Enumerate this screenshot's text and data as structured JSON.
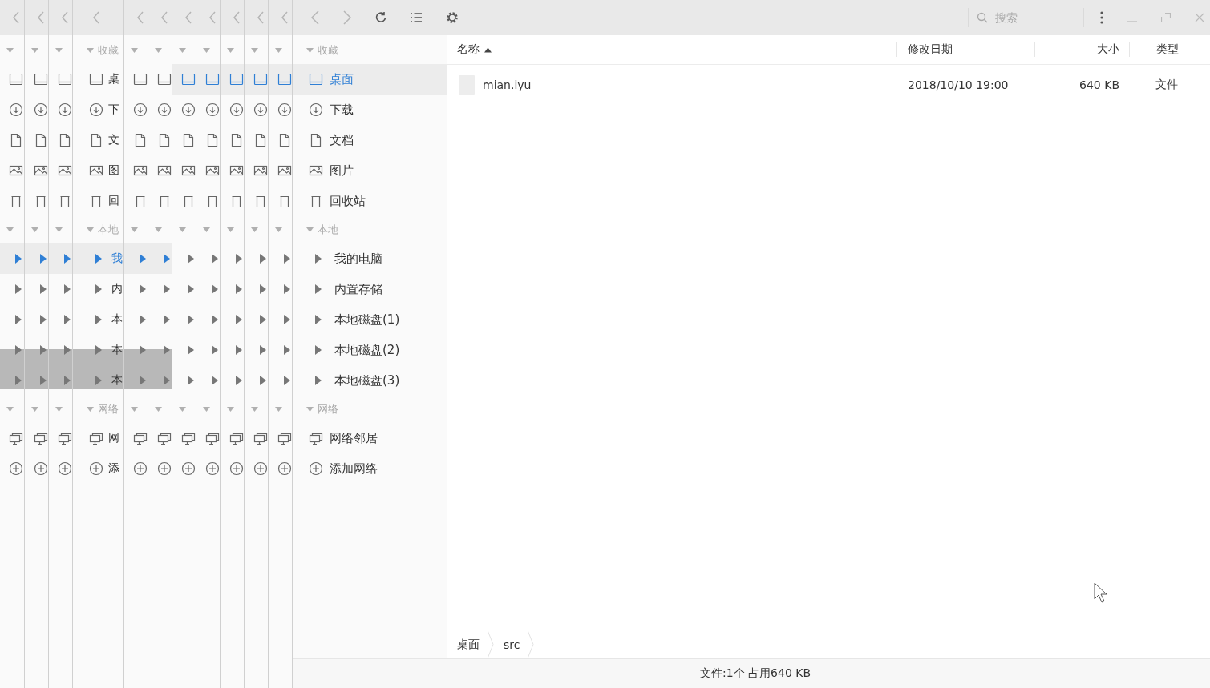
{
  "toolbar": {
    "search": {
      "placeholder": "搜索"
    }
  },
  "ghost": {
    "slices": [
      {
        "stale": true
      },
      {
        "stale": true
      },
      {
        "stale": true
      },
      {
        "stale": true,
        "labels": [
          "收藏",
          "桌",
          "下",
          "文",
          "图",
          "回",
          "本地",
          "我",
          "内",
          "本",
          "本",
          "本",
          "网络",
          "网",
          "添"
        ]
      },
      {
        "stale": true
      },
      {
        "stale": true
      },
      {
        "stale": false
      },
      {
        "stale": false
      },
      {
        "stale": false
      },
      {
        "stale": false
      },
      {
        "stale": false
      }
    ]
  },
  "sidebar": {
    "sections": [
      {
        "title": "收藏",
        "items": [
          {
            "label": "桌面",
            "kind": "desktop",
            "selected": true
          },
          {
            "label": "下载",
            "kind": "download",
            "selected": false
          },
          {
            "label": "文档",
            "kind": "document",
            "selected": false
          },
          {
            "label": "图片",
            "kind": "picture",
            "selected": false
          },
          {
            "label": "回收站",
            "kind": "trash",
            "selected": false
          }
        ]
      },
      {
        "title": "本地",
        "items": [
          {
            "label": "我的电脑",
            "kind": "drive",
            "selected": false
          },
          {
            "label": "内置存储",
            "kind": "drive",
            "selected": false
          },
          {
            "label": "本地磁盘(1)",
            "kind": "drive",
            "selected": false
          },
          {
            "label": "本地磁盘(2)",
            "kind": "drive",
            "selected": false
          },
          {
            "label": "本地磁盘(3)",
            "kind": "drive",
            "selected": false
          }
        ]
      },
      {
        "title": "网络",
        "items": [
          {
            "label": "网络邻居",
            "kind": "network",
            "selected": false
          },
          {
            "label": "添加网络",
            "kind": "add",
            "selected": false
          }
        ]
      }
    ]
  },
  "table": {
    "columns": [
      {
        "label": "名称",
        "sorted": true
      },
      {
        "label": "修改日期",
        "sorted": false
      },
      {
        "label": "大小",
        "sorted": false
      },
      {
        "label": "类型",
        "sorted": false
      }
    ],
    "rows": [
      {
        "name": "mian.iyu",
        "date": "2018/10/10 19:00",
        "size": "640 KB",
        "type": "文件"
      }
    ]
  },
  "breadcrumb": [
    "桌面",
    "src"
  ],
  "status_bar": "文件:1个 占用640 KB"
}
